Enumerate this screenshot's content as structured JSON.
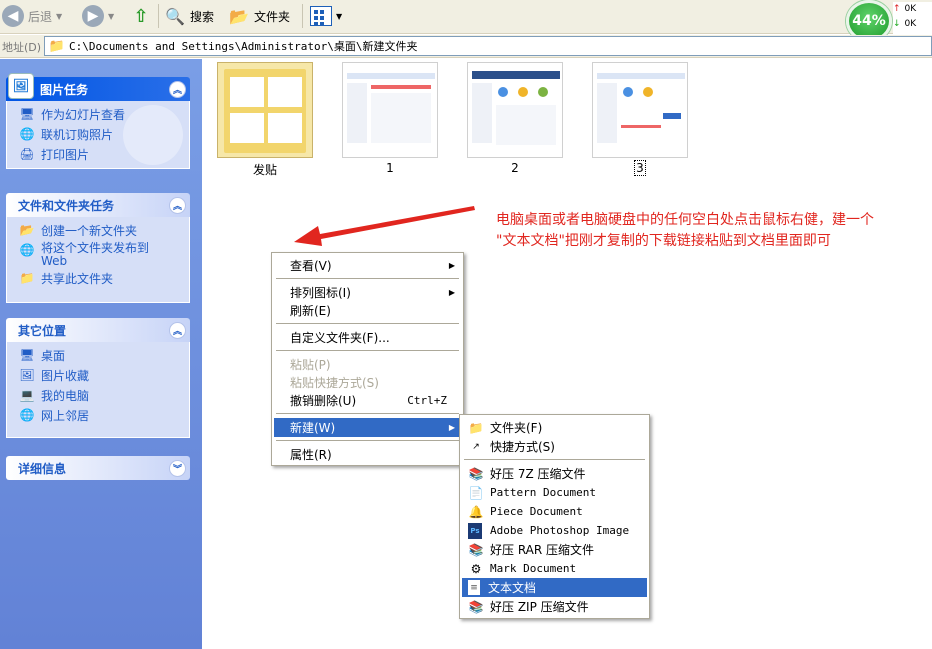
{
  "toolbar": {
    "back_label": "后退",
    "search_label": "搜索",
    "folders_label": "文件夹"
  },
  "address": {
    "label": "地址(D)",
    "path": "C:\\Documents and Settings\\Administrator\\桌面\\新建文件夹"
  },
  "badge": {
    "percent": "44%",
    "up": "0K",
    "down": "0K"
  },
  "sidebar": {
    "picture_tasks": {
      "title": "图片任务",
      "items": [
        "作为幻灯片查看",
        "联机订购照片",
        "打印图片"
      ]
    },
    "file_tasks": {
      "title": "文件和文件夹任务",
      "items": [
        "创建一个新文件夹",
        "将这个文件夹发布到 Web",
        "共享此文件夹"
      ]
    },
    "other_places": {
      "title": "其它位置",
      "items": [
        "桌面",
        "图片收藏",
        "我的电脑",
        "网上邻居"
      ]
    },
    "details": {
      "title": "详细信息"
    }
  },
  "files": [
    {
      "name": "发贴"
    },
    {
      "name": "1"
    },
    {
      "name": "2"
    },
    {
      "name": "3"
    }
  ],
  "annotation": {
    "line1": "电脑桌面或者电脑硬盘中的任何空白处点击鼠标右健，建一个",
    "line2": "\"文本文档\"把刚才复制的下载链接粘贴到文档里面即可"
  },
  "context_menu": {
    "view": "查看(V)",
    "arrange": "排列图标(I)",
    "refresh": "刷新(E)",
    "customize": "自定义文件夹(F)...",
    "paste": "粘贴(P)",
    "paste_shortcut": "粘贴快捷方式(S)",
    "undo_delete": "撤销删除(U)",
    "undo_shortcut": "Ctrl+Z",
    "new": "新建(W)",
    "properties": "属性(R)"
  },
  "new_submenu": {
    "folder": "文件夹(F)",
    "shortcut": "快捷方式(S)",
    "items": [
      "好压 7Z 压缩文件",
      "Pattern Document",
      "Piece Document",
      "Adobe Photoshop Image",
      "好压 RAR 压缩文件",
      "Mark Document",
      "文本文档",
      "好压 ZIP 压缩文件"
    ]
  },
  "colors": {
    "selection": "#316ac5",
    "annotation": "#e1261f",
    "sidebar": "#6f92e0"
  }
}
